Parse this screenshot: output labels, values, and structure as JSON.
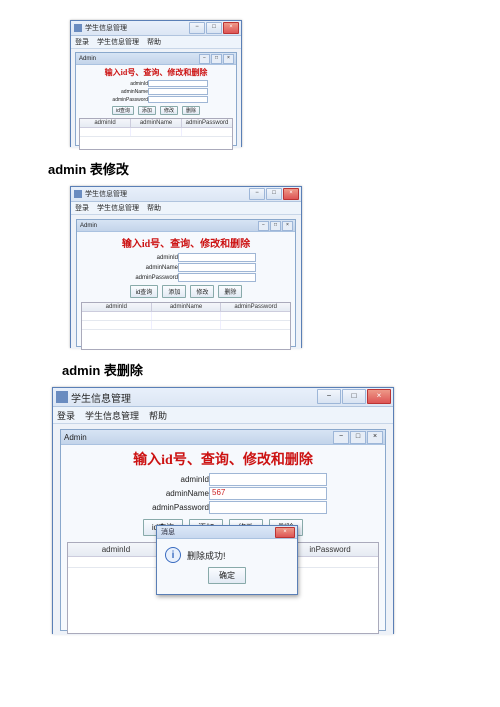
{
  "app": {
    "title": "学生信息管理",
    "menubar": [
      "登录",
      "学生信息管理",
      "帮助"
    ],
    "win_btns_tip": [
      "−",
      "□",
      "×"
    ]
  },
  "internal": {
    "title": "Admin",
    "int_btns_tip": [
      "−",
      "□",
      "×"
    ]
  },
  "heading": "输入id号、查询、修改和删除",
  "fields": {
    "id_label": "adminId",
    "name_label": "adminName",
    "pw_label": "adminPassword"
  },
  "buttons": {
    "id_search": "id查询",
    "add": "添加",
    "modify": "修改",
    "delete": "删除"
  },
  "table_cols": [
    "adminId",
    "adminName",
    "adminPassword"
  ],
  "section1_title": "admin 表修改",
  "section2_title": "admin 表删除",
  "s1": {
    "id_val": "",
    "name_val": "",
    "pw_val": "",
    "rows": [
      ""
    ]
  },
  "s2": {
    "id_val": "",
    "name_val": "",
    "pw_val": "",
    "rows": [
      "",
      ""
    ]
  },
  "s3": {
    "id_val": "",
    "name_val": "567",
    "pw_val": "",
    "table_col3_visible": "inPassword",
    "rows": [
      ""
    ]
  },
  "dialog": {
    "title": "消息",
    "message": "删除成功!",
    "ok": "确定",
    "close": "×"
  }
}
